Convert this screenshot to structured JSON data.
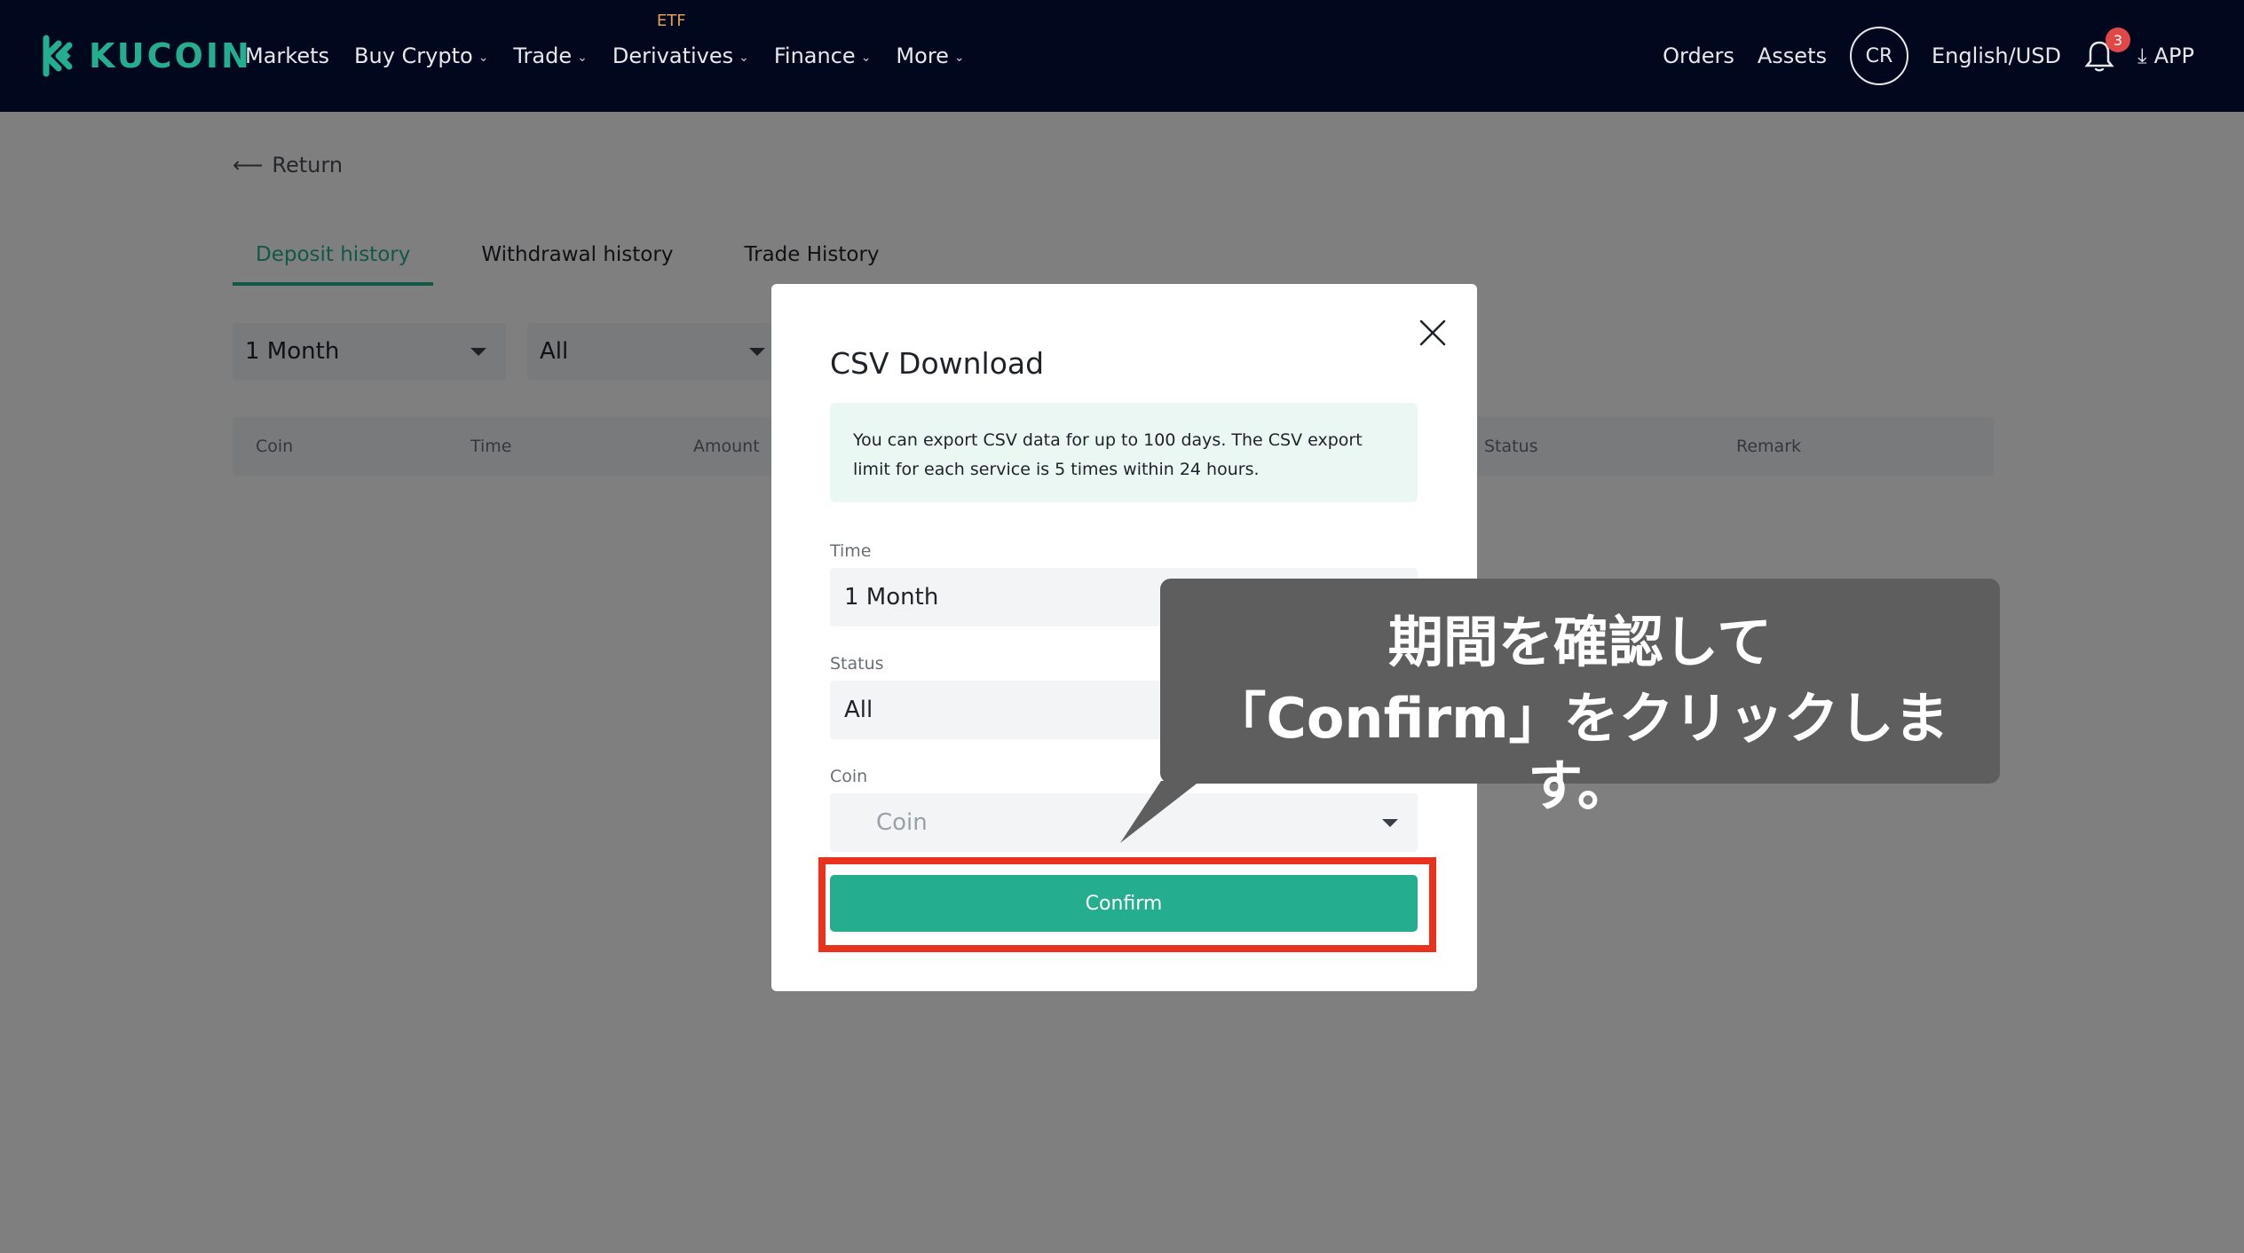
{
  "header": {
    "logo_text": "KUCOIN",
    "nav": [
      {
        "label": "Markets",
        "has_dropdown": false
      },
      {
        "label": "Buy Crypto",
        "has_dropdown": true
      },
      {
        "label": "Trade",
        "has_dropdown": true
      },
      {
        "label": "Derivatives",
        "has_dropdown": true,
        "tag": "ETF"
      },
      {
        "label": "Finance",
        "has_dropdown": true
      },
      {
        "label": "More",
        "has_dropdown": true
      }
    ],
    "orders": "Orders",
    "assets": "Assets",
    "avatar_initials": "CR",
    "language": "English/USD",
    "notification_count": "3",
    "app_label": "APP"
  },
  "page": {
    "return_label": "Return",
    "tabs": [
      "Deposit history",
      "Withdrawal history",
      "Trade History"
    ],
    "active_tab": "Deposit history",
    "filters": {
      "time": "1 Month",
      "status": "All"
    },
    "columns": [
      "Coin",
      "Time",
      "Amount",
      "Status",
      "Remark"
    ]
  },
  "modal": {
    "title": "CSV Download",
    "notice": "You can export CSV data for up to 100 days. The CSV export limit for each service is 5 times within 24 hours.",
    "time_label": "Time",
    "time_value": "1 Month",
    "status_label": "Status",
    "status_value": "All",
    "coin_label": "Coin",
    "coin_placeholder": "Coin",
    "confirm_label": "Confirm"
  },
  "annotation": {
    "line1": "期間を確認して",
    "line2": "「Confirm」をクリックします。"
  },
  "colors": {
    "brand": "#24ae8f",
    "header_bg": "#01081e",
    "highlight": "#e8321e",
    "callout_bg": "#5e5e5e"
  }
}
